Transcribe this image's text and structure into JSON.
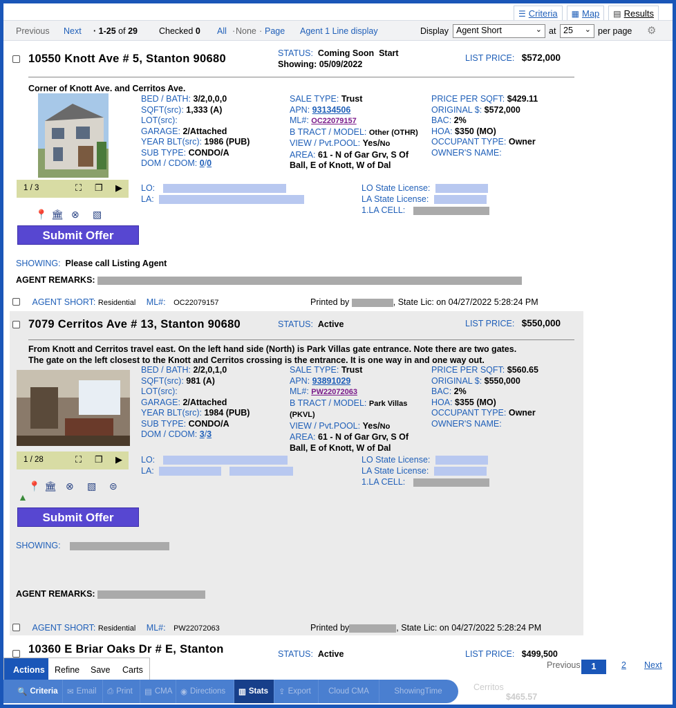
{
  "tabs": [
    {
      "label": "Criteria",
      "icon": "sliders-icon"
    },
    {
      "label": "Map",
      "icon": "map-icon"
    },
    {
      "label": "Results",
      "icon": "grid-icon"
    }
  ],
  "toolbar": {
    "previous": "Previous",
    "next": "Next",
    "range": "· 1-25",
    "of": "of",
    "total": "29",
    "checked_label": "Checked",
    "checked_count": "0",
    "all": "All",
    "none": "None",
    "page": "Page",
    "agent_1_line": "Agent 1 Line display",
    "display_label": "Display",
    "display_value": "Agent Short",
    "at_label": "at",
    "per_page_value": "25",
    "per_page_label": "per page"
  },
  "listings": [
    {
      "address": "10550 Knott Ave # 5, Stanton 90680",
      "status_label": "STATUS:",
      "status": "Coming Soon",
      "status_extra": "Start",
      "showing_line": "Showing: 05/09/2022",
      "list_price_label": "LIST PRICE:",
      "list_price": "$572,000",
      "directions": "Corner of Knott Ave. and Cerritos Ave.",
      "photo_counter": "1 / 3",
      "bed_bath": "3/2,0,0,0",
      "sqft": "1,333 (A)",
      "lot": "",
      "garage": "2/Attached",
      "year_built": "1986 (PUB)",
      "sub_type": "CONDO/A",
      "dom": "0",
      "cdom": "0",
      "sale_type": "Trust",
      "apn": "93134506",
      "ml": "OC22079157",
      "b_tract": "Other (OTHR)",
      "view_pool": "Yes/",
      "view_pool2": "No",
      "area": "61 - N of Gar Grv, S Of",
      "area2": "Ball, E of Knott, W of Dal",
      "price_per_sqft": "$429.11",
      "original_price": "$572,000",
      "bac": "2%",
      "hoa": "$350 (MO)",
      "occupant_type": "Owner",
      "showing_label": "SHOWING:",
      "showing_text": "Please call Listing Agent",
      "agent_remarks_label": "AGENT REMARKS:",
      "agent_short_label": "AGENT SHORT:",
      "agent_short_value": "Residential",
      "ml_label": "ML#:",
      "ml_short": "OC22079157",
      "printed_by": "Printed by",
      "state_lic": ", State Lic: on 04/27/2022 5:28:24 PM"
    },
    {
      "address": "7079 Cerritos Ave # 13, Stanton 90680",
      "status_label": "STATUS:",
      "status": "Active",
      "list_price_label": "LIST PRICE:",
      "list_price": "$550,000",
      "directions": "From Knott and Cerritos travel east. On the left hand side (North) is Park Villas gate entrance. Note there are two gates.",
      "directions2": "The gate on the left closest to the Knott and Cerritos crossing is the entrance. It is one way in and one way out.",
      "photo_counter": "1 / 28",
      "bed_bath": "2/2,0,1,0",
      "sqft": "981 (A)",
      "lot": "",
      "garage": "2/Attached",
      "year_built": "1984 (PUB)",
      "sub_type": "CONDO/A",
      "dom": "3",
      "cdom": "3",
      "sale_type": "Trust",
      "apn": "93891029",
      "ml": "PW22072063",
      "b_tract": "Park Villas",
      "b_tract2": "(PKVL)",
      "view_pool": "Yes/",
      "view_pool2": "No",
      "area": "61 - N of Gar Grv, S Of",
      "area2": "Ball, E of Knott, W of Dal",
      "price_per_sqft": "$560.65",
      "original_price": "$550,000",
      "bac": "2%",
      "hoa": "$355 (MO)",
      "occupant_type": "Owner",
      "showing_label": "SHOWING:",
      "agent_remarks_label": "AGENT REMARKS:",
      "agent_short_label": "AGENT SHORT:",
      "agent_short_value": "Residential",
      "ml_label": "ML#:",
      "ml_short": "PW22072063",
      "printed_by": "Printed by",
      "state_lic": ", State Lic: on 04/27/2022 5:28:24 PM"
    },
    {
      "address": "10360 E Briar Oaks Dr # E, Stanton",
      "status_label": "STATUS:",
      "status": "Active",
      "list_price_label": "LIST PRICE:",
      "list_price": "$499,500",
      "partial_text": "Cerritos",
      "partial_price": "$465.57"
    }
  ],
  "labels": {
    "bed_bath": "BED / BATH:",
    "sqft": "SQFT(src):",
    "lot": "LOT(src):",
    "garage": "GARAGE:",
    "year_built": "YEAR BLT(src):",
    "sub_type": "SUB TYPE:",
    "dom": "DOM / CDOM:",
    "sale_type": "SALE TYPE:",
    "apn": "APN:",
    "ml": "ML#:",
    "b_tract": "B TRACT / MODEL:",
    "view_pool": "VIEW / Pvt.POOL:",
    "area": "AREA:",
    "price_per_sqft": "PRICE PER SQFT:",
    "original_price": "ORIGINAL $:",
    "bac": "BAC:",
    "hoa": "HOA:",
    "occupant_type": "OCCUPANT TYPE:",
    "owner_name": "OWNER'S NAME:",
    "lo": "LO:",
    "la": "LA:",
    "lo_license": "LO State License:",
    "la_license": "LA State License:",
    "la_cell": "1.LA CELL:",
    "submit_offer": "Submit Offer"
  },
  "bottom": {
    "tabs": [
      "Actions",
      "Refine",
      "Save",
      "Carts"
    ],
    "actions": [
      "Criteria",
      "Email",
      "Print",
      "CMA",
      "Directions",
      "Stats",
      "Export",
      "Cloud CMA",
      "ShowingTime"
    ],
    "pager_previous": "Previous",
    "page1": "1",
    "page2": "2",
    "pager_next": "Next"
  },
  "colors": {
    "accent": "#1f5fb8",
    "submit": "#5747d1",
    "frame": "#1a56b8"
  }
}
